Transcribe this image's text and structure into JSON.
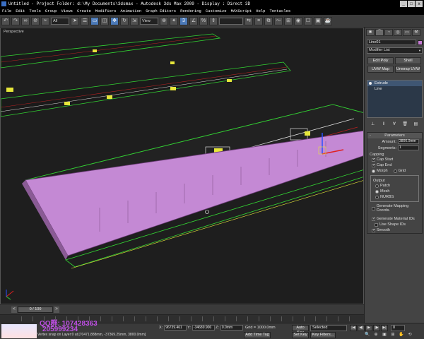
{
  "window": {
    "title": "Untitled   - Project Folder: d:\\My Documents\\3dsmax   - Autodesk 3ds Max  2009   - Display : Direct 3D",
    "min": "_",
    "max": "□",
    "close": "x"
  },
  "menu": [
    "File",
    "Edit",
    "Tools",
    "Group",
    "Views",
    "Create",
    "Modifiers",
    "Animation",
    "Graph Editors",
    "Rendering",
    "Customize",
    "MAXScript",
    "Help",
    "Tentacles"
  ],
  "toolbar": {
    "filter_value": "All",
    "view_value": "View",
    "icons": [
      "undo-icon",
      "redo-icon",
      "link-icon",
      "unlink-icon",
      "bind-spacewarp-icon",
      "filter",
      "select-icon",
      "select-by-name-icon",
      "rect-region-icon",
      "window-crossing-icon",
      "move-icon",
      "rotate-icon",
      "scale-icon",
      "view",
      "pivot-icon",
      "select-manipulate-icon",
      "snap-toggle-icon",
      "angle-snap-icon",
      "percent-snap-icon",
      "spinner-snap-icon",
      "named-sel-icon",
      "mirror-icon",
      "align-icon",
      "layer-manager-icon",
      "curve-editor-icon",
      "schematic-view-icon",
      "material-editor-icon",
      "render-setup-icon",
      "rendered-frame-icon",
      "render-icon"
    ],
    "glyphs": [
      "↶",
      "↷",
      "∞",
      "⊘",
      "≈",
      "",
      "➤",
      "☰",
      "▭",
      "◫",
      "✥",
      "↻",
      "⇲",
      "",
      "⊕",
      "✦",
      "3",
      "∠",
      "%",
      "⇕",
      "▤",
      "⇆",
      "≡",
      "⧉",
      "〜",
      "⊞",
      "◉",
      "☐",
      "▣",
      "☕"
    ]
  },
  "viewport": {
    "label": "Perspective"
  },
  "command_panel": {
    "tabs": [
      "✱",
      "⌒",
      "◔",
      "◎",
      "▭",
      "⚒"
    ],
    "object_name": "Line01",
    "object_color": "#c57ad3",
    "modifier_list": "Modifier List",
    "mod_buttons": [
      "Edit Poly",
      "Shell",
      "UVW Map",
      "Unwrap UVW"
    ],
    "stack": [
      "Extrude",
      "Line"
    ],
    "stack_tools": [
      "⊥",
      "‖",
      "∀",
      "🗑",
      "▤"
    ],
    "parameters": {
      "header": "Parameters",
      "amount_label": "Amount:",
      "amount_value": "3800.0mm",
      "segments_label": "Segments:",
      "segments_value": "1",
      "capping_label": "Capping",
      "cap_start": "Cap Start",
      "cap_end": "Cap End",
      "morph": "Morph",
      "grid": "Grid",
      "output_label": "Output",
      "patch": "Patch",
      "mesh": "Mesh",
      "nurbs": "NURBS",
      "gen_mapping": "Generate Mapping Coords.",
      "gen_material_ids": "Generate Material IDs",
      "use_shape_ids": "Use Shape IDs",
      "smooth": "Smooth"
    }
  },
  "timeline": {
    "slider": "0 / 100",
    "prev": "<",
    "next": ">"
  },
  "status": {
    "qq1": "QQ群: 107428363",
    "qq2": "205999234",
    "x_label": "X:",
    "x_value": "96739.461",
    "y_label": "Y:",
    "y_value": "-34689.906",
    "z_label": "Z:",
    "z_value": "0.0mm",
    "grid": "Grid = 1000.0mm",
    "auto_key": "Auto Key",
    "set_key": "Set Key",
    "selected": "Selected",
    "key_filters": "Key Filters...",
    "add_time_tag": "Add Time Tag",
    "prompt": "Vertex snap on Layer:0 at [70471.888mm, -37369.25mm, 3800.0mm]",
    "play": [
      "|◀",
      "◀|",
      "▶",
      "|▶",
      "▶|"
    ],
    "frame": "0",
    "nav": [
      "🔍",
      "⊕",
      "▣",
      "⊞",
      "✋",
      "⟲",
      "⤢",
      "◱"
    ]
  }
}
